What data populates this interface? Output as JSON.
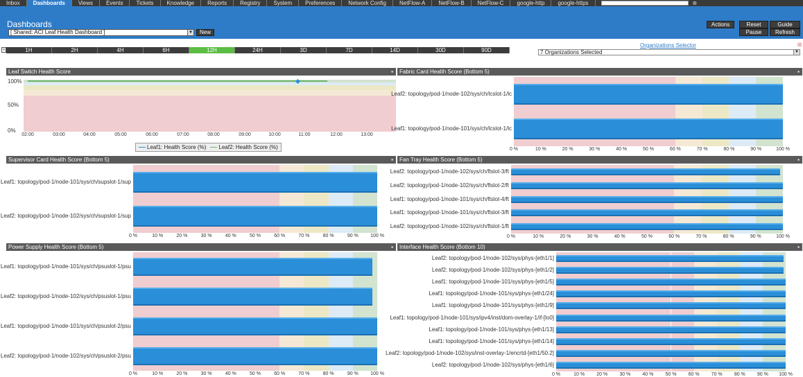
{
  "nav": {
    "items": [
      "Inbox",
      "Dashboards",
      "Views",
      "Events",
      "Tickets",
      "Knowledge",
      "Reports",
      "Registry",
      "System",
      "Preferences",
      "Network Config",
      "NetFlow-A",
      "NetFlow-B",
      "NetFlow-C",
      "google-http",
      "google-https"
    ],
    "active": 1
  },
  "header": {
    "title": "Dashboards",
    "selector": "[ Shared: ACI Leaf Health Dashboard ]",
    "new": "New",
    "actions": "Actions",
    "reset": "Reset",
    "guide": "Guide",
    "pause": "Pause",
    "refresh": "Refresh"
  },
  "timebar": {
    "ranges": [
      "1H",
      "2H",
      "4H",
      "6H",
      "12H",
      "24H",
      "3D",
      "7D",
      "14D",
      "30D",
      "90D"
    ],
    "active": 4
  },
  "org": {
    "link": "Organizations Selector",
    "selected": "7 Organizations Selected"
  },
  "colors": {
    "bands": [
      "#f0cdd0",
      "#f0cdd0",
      "#f0cdd0",
      "#f0cdd0",
      "#f0cdd0",
      "#f0cdd0",
      "#f5e9d5",
      "#ece8c5",
      "#dcebf5",
      "#d2e3d0"
    ],
    "bar": "#2a8fd8"
  },
  "xticks": [
    "0 %",
    "10 %",
    "20 %",
    "30 %",
    "40 %",
    "50 %",
    "60 %",
    "70 %",
    "80 %",
    "90 %",
    "100 %"
  ],
  "leaf": {
    "title": "Leaf Switch Health Score",
    "yticks": [
      "100%",
      "50%",
      "0%"
    ],
    "times": [
      "02:00",
      "03:00",
      "04:00",
      "05:00",
      "06:00",
      "07:00",
      "08:00",
      "09:00",
      "10:00",
      "11:00",
      "12:00",
      "13:00"
    ],
    "legend": [
      "Leaf1: Health Score (%)",
      "Leaf2: Health Score (%)"
    ]
  },
  "panels": {
    "fabric": {
      "title": "Fabric Card Health Score (Bottom 5)",
      "rows": [
        {
          "label": "Leaf2: topology/pod-1/node-102/sys/ch/lcslot-1/lc",
          "value": 100
        },
        {
          "label": "Leaf1: topology/pod-1/node-101/sys/ch/lcslot-1/lc",
          "value": 100
        }
      ]
    },
    "sup": {
      "title": "Supervisor Card Health Score (Bottom 5)",
      "rows": [
        {
          "label": "Leaf1: topology/pod-1/node-101/sys/ch/supslot-1/sup",
          "value": 100
        },
        {
          "label": "Leaf2: topology/pod-1/node-102/sys/ch/supslot-1/sup",
          "value": 100
        }
      ]
    },
    "fan": {
      "title": "Fan Tray Health Score (Bottom 5)",
      "rows": [
        {
          "label": "Leaf2: topology/pod-1/node-102/sys/ch/ftslot-3/ft",
          "value": 99
        },
        {
          "label": "Leaf2: topology/pod-1/node-102/sys/ch/ftslot-2/ft",
          "value": 100
        },
        {
          "label": "Leaf1: topology/pod-1/node-101/sys/ch/ftslot-4/ft",
          "value": 100
        },
        {
          "label": "Leaf1: topology/pod-1/node-101/sys/ch/ftslot-3/ft",
          "value": 100
        },
        {
          "label": "Leaf2: topology/pod-1/node-102/sys/ch/ftslot-1/ft",
          "value": 100
        }
      ]
    },
    "psu": {
      "title": "Power Supply Health Score (Bottom 5)",
      "rows": [
        {
          "label": "Leaf1: topology/pod-1/node-101/sys/ch/psuslot-1/psu",
          "value": 98
        },
        {
          "label": "Leaf2: topology/pod-1/node-102/sys/ch/psuslot-1/psu",
          "value": 98
        },
        {
          "label": "Leaf1: topology/pod-1/node-101/sys/ch/psuslot-2/psu",
          "value": 100
        },
        {
          "label": "Leaf2: topology/pod-1/node-102/sys/ch/psuslot-2/psu",
          "value": 100
        }
      ]
    },
    "iface": {
      "title": "Interface Health Score (Bottom 10)",
      "rows": [
        {
          "label": "Leaf2: topology/pod-1/node-102/sys/phys-[eth1/1]",
          "value": 99
        },
        {
          "label": "Leaf2: topology/pod-1/node-102/sys/phys-[eth1/2]",
          "value": 99
        },
        {
          "label": "Leaf1: topology/pod-1/node-101/sys/phys-[eth1/5]",
          "value": 100
        },
        {
          "label": "Leaf1: topology/pod-1/node-101/sys/phys-[eth1/24]",
          "value": 100
        },
        {
          "label": "Leaf1: topology/pod-1/node-101/sys/phys-[eth1/9]",
          "value": 100
        },
        {
          "label": "Leaf1: topology/pod-1/node-101/sys/ipv4/inst/dom-overlay-1/if-[lo0]",
          "value": 100
        },
        {
          "label": "Leaf1: topology/pod-1/node-101/sys/phys-[eth1/13]",
          "value": 100
        },
        {
          "label": "Leaf1: topology/pod-1/node-101/sys/phys-[eth1/14]",
          "value": 100
        },
        {
          "label": "Leaf2: topology/pod-1/node-102/sys/inst-overlay-1/encrtd-[eth1/50.2]",
          "value": 100
        },
        {
          "label": "Leaf2: topology/pod-1/node-102/sys/phys-[eth1/6]",
          "value": 100
        }
      ]
    }
  }
}
